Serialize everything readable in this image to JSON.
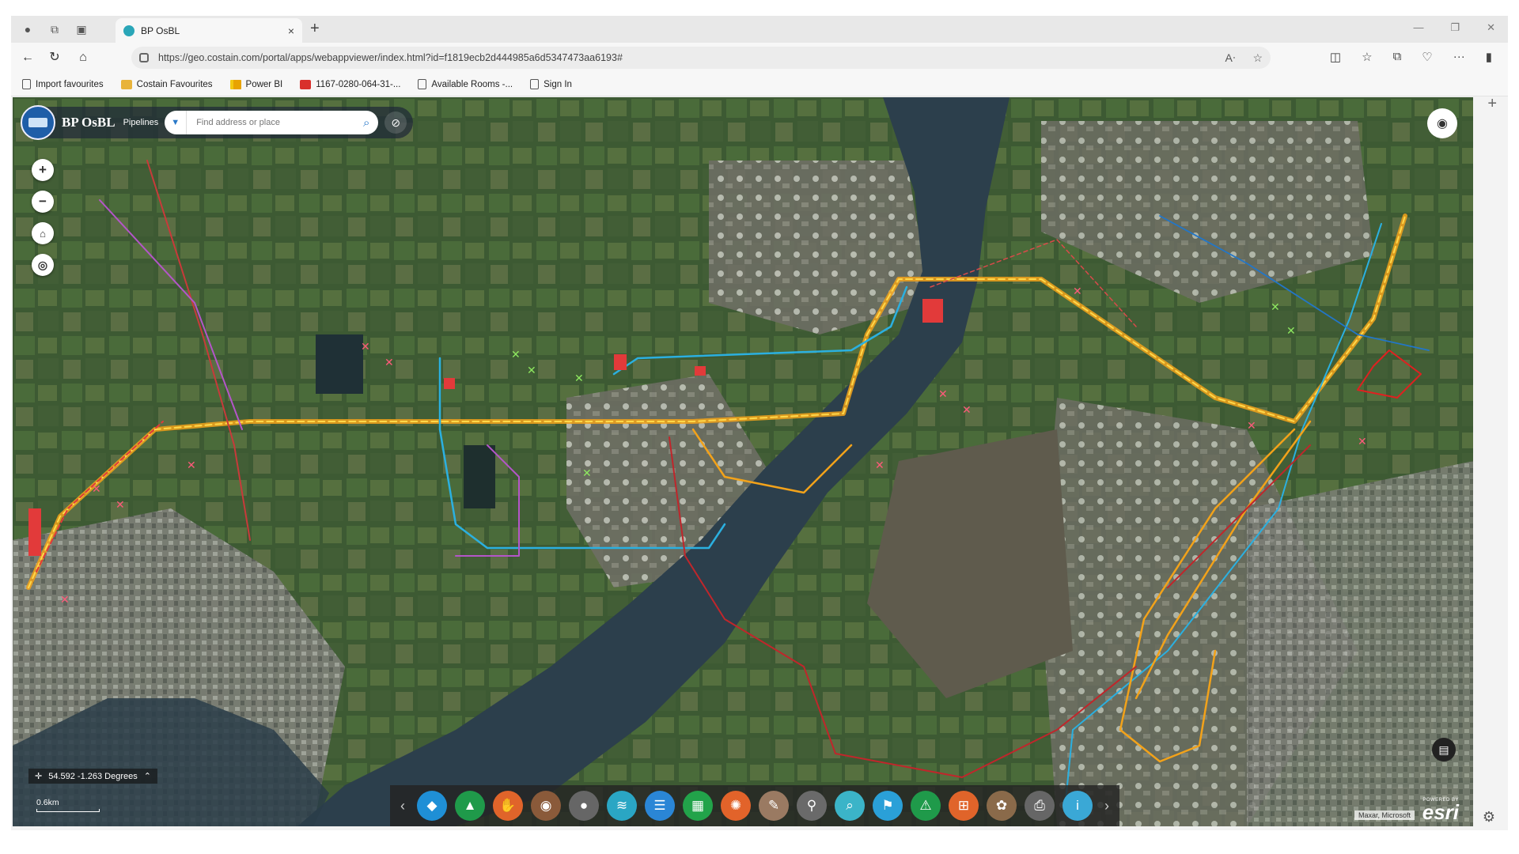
{
  "browser": {
    "tab_title": "BP OsBL",
    "tab_close": "×",
    "new_tab": "+",
    "url": "https://geo.costain.com/portal/apps/webappviewer/index.html?id=f1819ecb2d444985a6d5347473aa6193#",
    "bookmarks": [
      {
        "label": "Import favourites",
        "icon": "page-icon"
      },
      {
        "label": "Costain Favourites",
        "icon": "folder-icon"
      },
      {
        "label": "Power BI",
        "icon": "powerbi-icon"
      },
      {
        "label": "1167-0280-064-31-...",
        "icon": "pdf-icon"
      },
      {
        "label": "Available Rooms -...",
        "icon": "page-icon"
      },
      {
        "label": "Sign In",
        "icon": "page-icon"
      }
    ]
  },
  "app": {
    "title": "BP OsBL",
    "subtitle": "Pipelines",
    "search_placeholder": "Find address or place"
  },
  "map": {
    "coordinates": "54.592 -1.263 Degrees",
    "scale_label": "0.6km",
    "attribution": "Maxar, Microsoft",
    "esri_powered": "POWERED BY",
    "esri_word": "esri"
  },
  "toolbar": {
    "tools": [
      {
        "name": "layers-tool-icon",
        "color": "#1f8fd6",
        "glyph": "◆"
      },
      {
        "name": "basemap-tool-icon",
        "color": "#1f9a4a",
        "glyph": "▲"
      },
      {
        "name": "select-tool-icon",
        "color": "#e0642a",
        "glyph": "✋"
      },
      {
        "name": "globe-tool-icon",
        "color": "#8a5a3a",
        "glyph": "◉"
      },
      {
        "name": "person-tool-icon",
        "color": "#666666",
        "glyph": "●"
      },
      {
        "name": "stack-tool-icon",
        "color": "#2aa6c4",
        "glyph": "≋"
      },
      {
        "name": "list-tool-icon",
        "color": "#2a86d6",
        "glyph": "☰"
      },
      {
        "name": "grid-tool-icon",
        "color": "#22a34a",
        "glyph": "▦"
      },
      {
        "name": "network-tool-icon",
        "color": "#e2632a",
        "glyph": "✺"
      },
      {
        "name": "measure-tool-icon",
        "color": "#9a7a62",
        "glyph": "✎"
      },
      {
        "name": "pin-tool-icon",
        "color": "#6a6a6a",
        "glyph": "⚲"
      },
      {
        "name": "query-tool-icon",
        "color": "#3bb4c8",
        "glyph": "⌕"
      },
      {
        "name": "bookmark-tool-icon",
        "color": "#2aa0d8",
        "glyph": "⚑"
      },
      {
        "name": "warning-tool-icon",
        "color": "#1f9a4a",
        "glyph": "⚠"
      },
      {
        "name": "frame-tool-icon",
        "color": "#e0642a",
        "glyph": "⊞"
      },
      {
        "name": "draw-tool-icon",
        "color": "#8a6a4a",
        "glyph": "✿"
      },
      {
        "name": "print-tool-icon",
        "color": "#666666",
        "glyph": "⎙"
      },
      {
        "name": "info-tool-icon",
        "color": "#3aa8d6",
        "glyph": "i"
      }
    ]
  }
}
